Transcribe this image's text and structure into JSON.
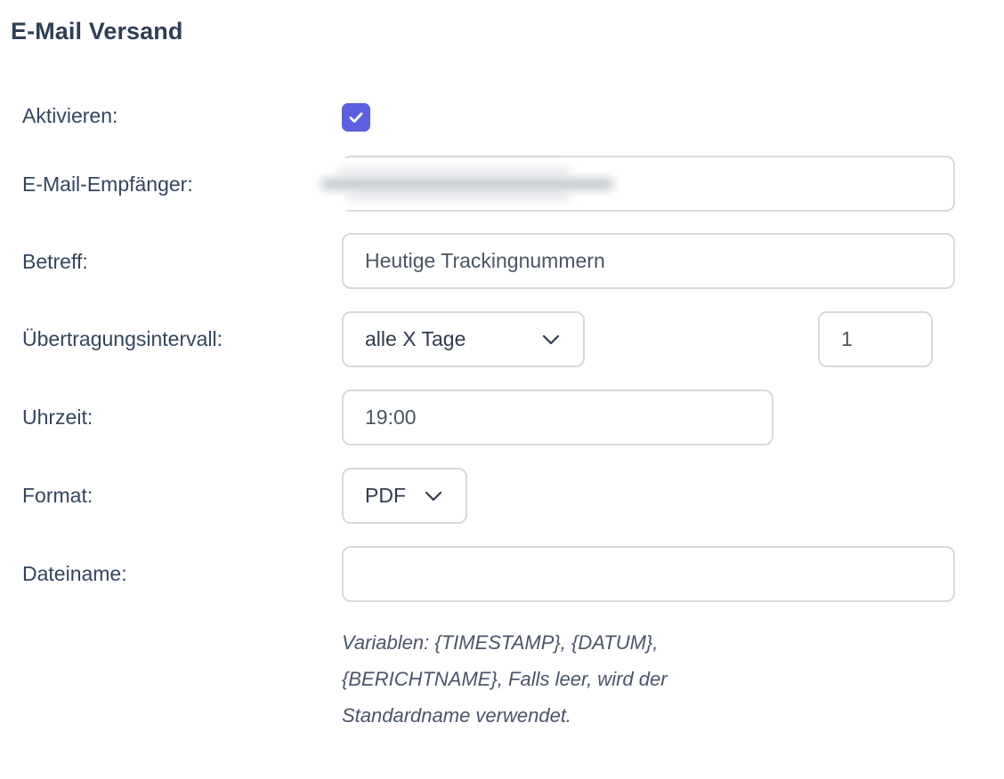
{
  "section": {
    "title": "E-Mail Versand"
  },
  "form": {
    "activate": {
      "label": "Aktivieren:",
      "checked": true,
      "accent_color": "#5b5fe0"
    },
    "recipient": {
      "label": "E-Mail-Empfänger:",
      "value": ""
    },
    "subject": {
      "label": "Betreff:",
      "value": "Heutige Trackingnummern"
    },
    "interval": {
      "label": "Übertragungsintervall:",
      "selected": "alle X Tage",
      "count": "1"
    },
    "time": {
      "label": "Uhrzeit:",
      "value": "19:00"
    },
    "format": {
      "label": "Format:",
      "selected": "PDF"
    },
    "filename": {
      "label": "Dateiname:",
      "value": "",
      "help": "Variablen: {TIMESTAMP}, {DATUM}, {BERICHTNAME}, Falls leer, wird der Standardname verwendet."
    }
  },
  "icons": {
    "checkbox": "check-icon",
    "dropdown": "chevron-down-icon"
  }
}
